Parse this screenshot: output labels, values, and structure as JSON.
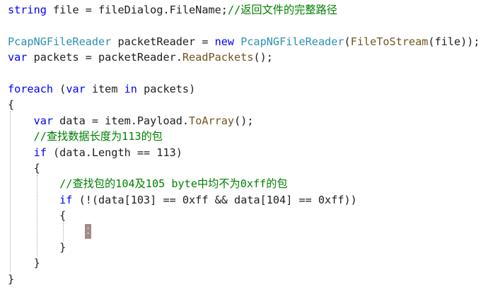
{
  "editor": {
    "language": "C#",
    "colors": {
      "keyword": "#0000ff",
      "type": "#2b91af",
      "method": "#74531f",
      "comment": "#008000",
      "text": "#1e1e1e",
      "caret": "#a58b86"
    },
    "lines": [
      {
        "tokens": [
          {
            "t": "string",
            "k": "kw"
          },
          {
            "t": " file = fileDialog.",
            "k": "plain"
          },
          {
            "t": "FileName",
            "k": "plain"
          },
          {
            "t": ";",
            "k": "plain"
          },
          {
            "t": "//返回文件的完整路径",
            "k": "cmt"
          }
        ]
      },
      {
        "tokens": []
      },
      {
        "tokens": [
          {
            "t": "PcapNGFileReader",
            "k": "type"
          },
          {
            "t": " packetReader = ",
            "k": "plain"
          },
          {
            "t": "new",
            "k": "kw"
          },
          {
            "t": " ",
            "k": "plain"
          },
          {
            "t": "PcapNGFileReader",
            "k": "type"
          },
          {
            "t": "(",
            "k": "plain"
          },
          {
            "t": "FileToStream",
            "k": "meth"
          },
          {
            "t": "(file));",
            "k": "plain"
          }
        ]
      },
      {
        "tokens": [
          {
            "t": "var",
            "k": "kw"
          },
          {
            "t": " packets = packetReader.",
            "k": "plain"
          },
          {
            "t": "ReadPackets",
            "k": "meth"
          },
          {
            "t": "();",
            "k": "plain"
          }
        ]
      },
      {
        "tokens": []
      },
      {
        "tokens": [
          {
            "t": "foreach",
            "k": "kw"
          },
          {
            "t": " (",
            "k": "plain"
          },
          {
            "t": "var",
            "k": "kw"
          },
          {
            "t": " item ",
            "k": "plain"
          },
          {
            "t": "in",
            "k": "kw"
          },
          {
            "t": " packets)",
            "k": "plain"
          }
        ]
      },
      {
        "tokens": [
          {
            "t": "{",
            "k": "plain"
          }
        ]
      },
      {
        "tokens": [
          {
            "t": "    ",
            "k": "plain"
          },
          {
            "t": "var",
            "k": "kw"
          },
          {
            "t": " data = item.Payload.",
            "k": "plain"
          },
          {
            "t": "ToArray",
            "k": "meth"
          },
          {
            "t": "();",
            "k": "plain"
          }
        ]
      },
      {
        "tokens": [
          {
            "t": "    ",
            "k": "plain"
          },
          {
            "t": "//查找数据长度为113的包",
            "k": "cmt"
          }
        ]
      },
      {
        "tokens": [
          {
            "t": "    ",
            "k": "plain"
          },
          {
            "t": "if",
            "k": "kw"
          },
          {
            "t": " (data.Length == 113)",
            "k": "plain"
          }
        ]
      },
      {
        "tokens": [
          {
            "t": "    {",
            "k": "plain"
          }
        ]
      },
      {
        "tokens": [
          {
            "t": "        ",
            "k": "plain"
          },
          {
            "t": "//查找包的104及105 byte中均不为0xff的包",
            "k": "cmt"
          }
        ]
      },
      {
        "tokens": [
          {
            "t": "        ",
            "k": "plain"
          },
          {
            "t": "if",
            "k": "kw"
          },
          {
            "t": " (!(data[103] == 0xff && data[104] == 0xff))",
            "k": "plain"
          }
        ]
      },
      {
        "tokens": [
          {
            "t": "        {",
            "k": "plain"
          }
        ]
      },
      {
        "tokens": []
      },
      {
        "tokens": [
          {
            "t": "        }",
            "k": "plain"
          }
        ]
      },
      {
        "tokens": [
          {
            "t": "    }",
            "k": "plain"
          }
        ]
      },
      {
        "tokens": [
          {
            "t": "}",
            "k": "plain"
          }
        ]
      }
    ]
  }
}
